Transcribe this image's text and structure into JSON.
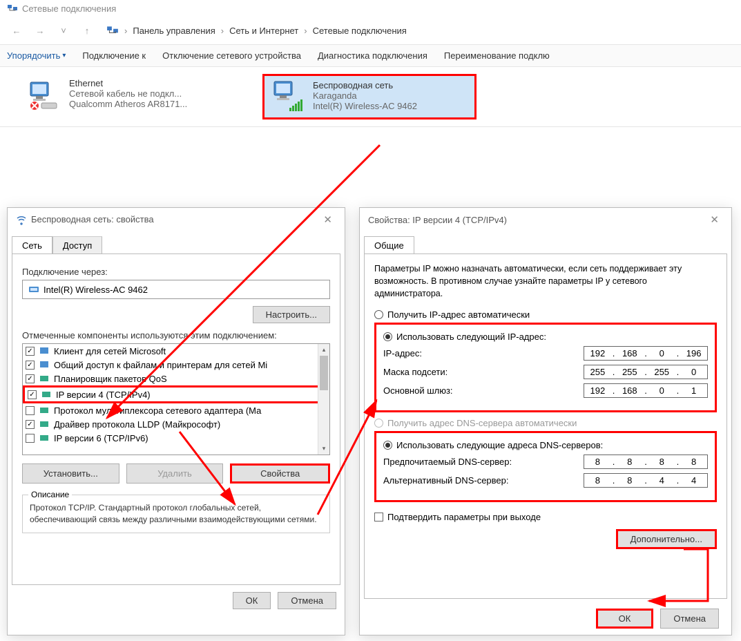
{
  "window": {
    "title": "Сетевые подключения"
  },
  "breadcrumb": {
    "p1": "Панель управления",
    "p2": "Сеть и Интернет",
    "p3": "Сетевые подключения"
  },
  "toolbar": {
    "organize": "Упорядочить",
    "connect": "Подключение к",
    "disable": "Отключение сетевого устройства",
    "diag": "Диагностика подключения",
    "rename": "Переименование подклю"
  },
  "connections": {
    "ethernet": {
      "name": "Ethernet",
      "status": "Сетевой кабель не подкл...",
      "device": "Qualcomm Atheros AR8171..."
    },
    "wifi": {
      "name": "Беспроводная сеть",
      "status": "Karaganda",
      "device": "Intel(R) Wireless-AC 9462"
    }
  },
  "dlg1": {
    "title": "Беспроводная сеть: свойства",
    "tab_net": "Сеть",
    "tab_access": "Доступ",
    "connect_label": "Подключение через:",
    "device": "Intel(R) Wireless-AC 9462",
    "configure": "Настроить...",
    "components_label": "Отмеченные компоненты используются этим подключением:",
    "items": [
      "Клиент для сетей Microsoft",
      "Общий доступ к файлам и принтерам для сетей Mi",
      "Планировщик пакетов QoS",
      "IP версии 4 (TCP/IPv4)",
      "Протокол мультиплексора сетевого адаптера (Ма",
      "Драйвер протокола LLDP (Майкрософт)",
      "IP версии 6 (TCP/IPv6)"
    ],
    "install": "Установить...",
    "remove": "Удалить",
    "properties": "Свойства",
    "desc_title": "Описание",
    "desc": "Протокол TCP/IP. Стандартный протокол глобальных сетей, обеспечивающий связь между различными взаимодействующими сетями.",
    "ok": "ОК",
    "cancel": "Отмена"
  },
  "dlg2": {
    "title": "Свойства: IP версии 4 (TCP/IPv4)",
    "tab": "Общие",
    "para": "Параметры IP можно назначать автоматически, если сеть поддерживает эту возможность. В противном случае узнайте параметры IP у сетевого администратора.",
    "auto_ip": "Получить IP-адрес автоматически",
    "manual_ip": "Использовать следующий IP-адрес:",
    "ip_label": "IP-адрес:",
    "mask_label": "Маска подсети:",
    "gw_label": "Основной шлюз:",
    "ip": [
      "192",
      "168",
      "0",
      "196"
    ],
    "mask": [
      "255",
      "255",
      "255",
      "0"
    ],
    "gw": [
      "192",
      "168",
      "0",
      "1"
    ],
    "auto_dns": "Получить адрес DNS-сервера автоматически",
    "manual_dns": "Использовать следующие адреса DNS-серверов:",
    "dns1_label": "Предпочитаемый DNS-сервер:",
    "dns2_label": "Альтернативный DNS-сервер:",
    "dns1": [
      "8",
      "8",
      "8",
      "8"
    ],
    "dns2": [
      "8",
      "8",
      "4",
      "4"
    ],
    "validate": "Подтвердить параметры при выходе",
    "advanced": "Дополнительно...",
    "ok": "ОК",
    "cancel": "Отмена"
  }
}
